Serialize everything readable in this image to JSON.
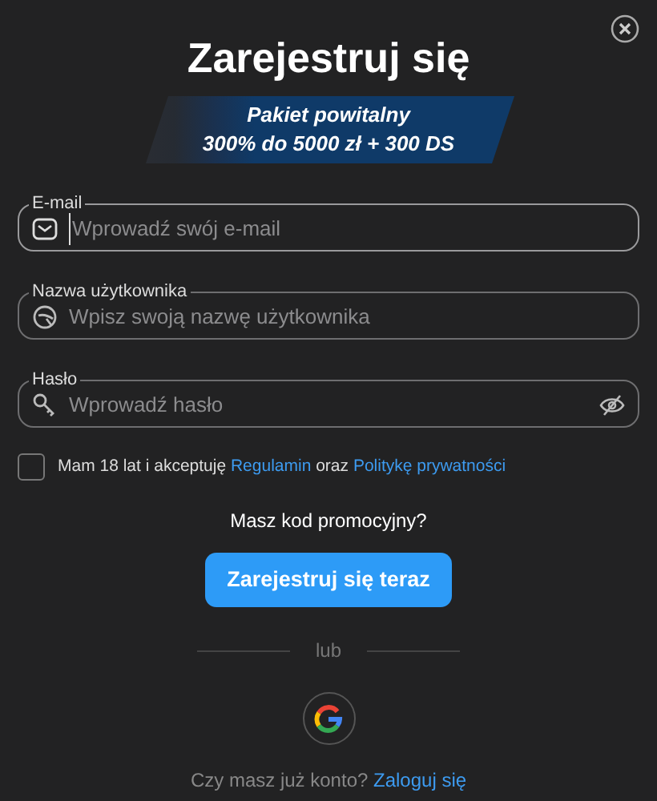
{
  "title": "Zarejestruj się",
  "banner": {
    "line_1": "Pakiet powitalny",
    "line_2": "300% do 5000 zł + 300 DS"
  },
  "fields": [
    {
      "kind": "email",
      "label": "E-mail",
      "placeholder": "Wprowadź swój e-mail",
      "focused": true
    },
    {
      "kind": "username",
      "label": "Nazwa użytkownika",
      "placeholder": "Wpisz swoją nazwę użytkownika",
      "focused": false
    },
    {
      "kind": "password",
      "label": "Hasło",
      "placeholder": "Wprowadź hasło",
      "focused": false
    }
  ],
  "consent": {
    "checked": false,
    "text_1": "Mam 18 lat i akceptuję",
    "link_1": "Regulamin",
    "text_2": "oraz",
    "link_2": "Politykę prywatności"
  },
  "promo_link": "Masz kod promocyjny?",
  "submit_button": "Zarejestruj się teraz",
  "divider": "lub",
  "login": {
    "question": "Czy masz już konto?",
    "link": "Zaloguj się"
  }
}
